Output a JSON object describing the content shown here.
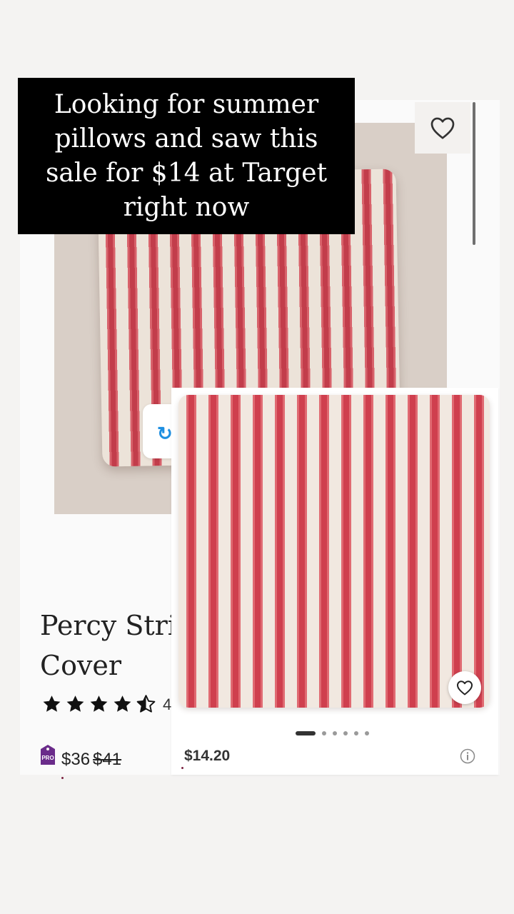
{
  "caption": "Looking for summer pillows and saw this sale for $14 at Target right now",
  "back_product": {
    "title": "Percy Strip Cover",
    "title_line1": "Percy Strip",
    "title_line2": "Cover",
    "rating": 4.5,
    "rating_count": "4",
    "pro_badge_text": "PRO",
    "price": "$36",
    "original_price": "$41",
    "heart_icon": "heart-outline-icon"
  },
  "front_product": {
    "price": "$14.20",
    "carousel": {
      "total": 6,
      "active_index": 0
    },
    "heart_icon": "heart-outline-icon",
    "info_icon": "info-icon"
  },
  "colors": {
    "caption_bg": "#000000",
    "stripe_red": "#cf3f4e",
    "pro_badge": "#6a2b8a"
  }
}
